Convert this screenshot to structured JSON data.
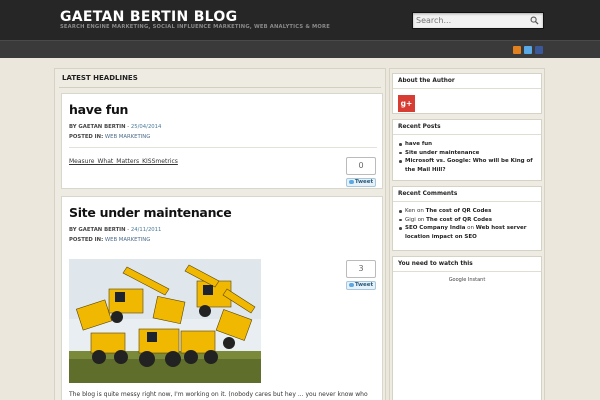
{
  "header": {
    "title": "GAETAN BERTIN BLOG",
    "tagline": "SEARCH ENGINE MARKETING, SOCIAL INFLUENCE MARKETING, WEB ANALYTICS & MORE",
    "search_placeholder": "Search..."
  },
  "social": {
    "icons": [
      "rss-icon",
      "twitter-icon",
      "facebook-icon"
    ],
    "colors": [
      "#e0801e",
      "#5aa9e6",
      "#3b5998"
    ]
  },
  "main": {
    "section_title": "LATEST HEADLINES",
    "posts": [
      {
        "title": "have fun",
        "by_label": "BY GAETAN BERTIN",
        "date": "25/04/2014",
        "posted_in_label": "POSTED IN:",
        "category": "WEB MARKETING",
        "link": "Measure_What_Matters_KISSmetrics",
        "tweet_count": "0",
        "tweet_label": "Tweet"
      },
      {
        "title": "Site under maintenance",
        "by_label": "BY GAETAN BERTIN",
        "date": "24/11/2011",
        "posted_in_label": "POSTED IN:",
        "category": "WEB MARKETING",
        "tweet_count": "3",
        "tweet_label": "Tweet",
        "excerpt": "The blog is quite messy right now, I'm working on it. (nobody cares but hey ... you never know who"
      }
    ]
  },
  "sidebar": {
    "about": {
      "title": "About the Author",
      "icon": "google-plus-icon",
      "icon_text": "g+"
    },
    "recent_posts": {
      "title": "Recent Posts",
      "items": [
        "have fun",
        "Site under maintenance",
        "Microsoft vs. Google: Who will be King of",
        "the Mail Hill?"
      ]
    },
    "recent_comments": {
      "title": "Recent Comments",
      "items": [
        {
          "author": "Ken",
          "on": "on",
          "post": "The cost of QR Codes"
        },
        {
          "author": "Gigi",
          "on": "on",
          "post": "The cost of QR Codes"
        },
        {
          "author": "SEO Company India",
          "on": "on",
          "post": "Web host server"
        },
        {
          "author": "",
          "on": "",
          "post": "location impact on SEO"
        }
      ]
    },
    "watch": {
      "title": "You need to watch this",
      "text": "Google Instant"
    }
  }
}
